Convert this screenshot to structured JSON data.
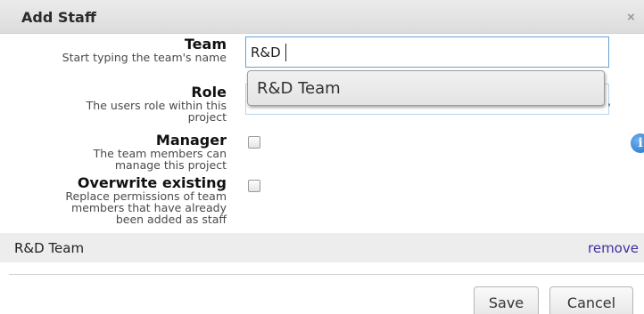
{
  "dialog": {
    "title": "Add Staff",
    "close_glyph": "×"
  },
  "fields": {
    "team": {
      "label": "Team",
      "description": "Start typing the team's name",
      "value": "R&D"
    },
    "role": {
      "label": "Role",
      "description_line1": "The users role within this",
      "description_line2": "project",
      "value": ""
    },
    "manager": {
      "label": "Manager",
      "description_line1": "The team members can",
      "description_line2": "manage this project",
      "checked": false
    },
    "overwrite": {
      "label": "Overwrite existing",
      "description_line1": "Replace permissions of team",
      "description_line2": "members that have already",
      "description_line3": "been added as staff",
      "checked": false
    }
  },
  "autocomplete": {
    "suggestions": [
      "R&D Team"
    ]
  },
  "info_icon": {
    "icon": "info-icon",
    "glyph": "i"
  },
  "staff_list": [
    {
      "team": "R&D Team",
      "action": "remove"
    }
  ],
  "buttons": {
    "save": "Save",
    "cancel": "Cancel"
  },
  "colors": {
    "input_focus_border": "#6a9fd6",
    "link": "#3d2fa0",
    "info_icon": "#1f6fc5"
  }
}
